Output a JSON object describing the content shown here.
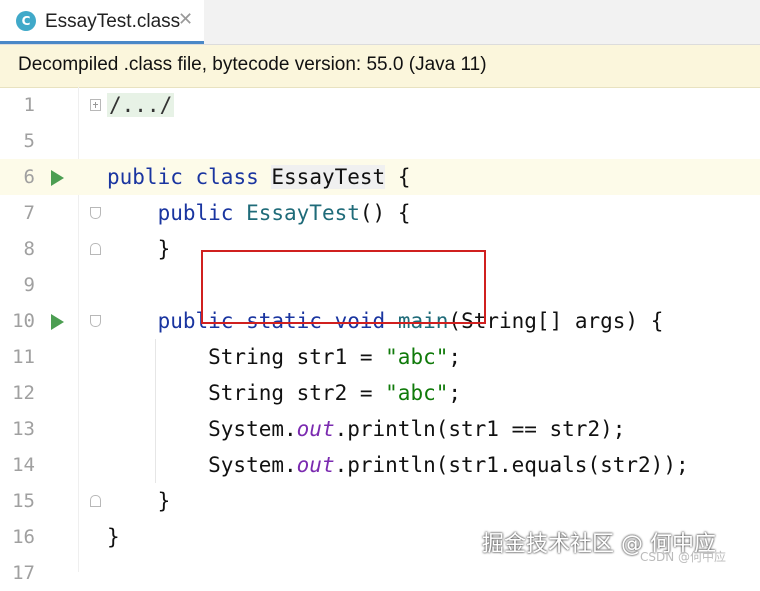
{
  "tab": {
    "icon_letter": "C",
    "icon": "class-file-icon",
    "label": "EssayTest.class",
    "close": "✕"
  },
  "banner": {
    "text": "Decompiled .class file, bytecode version: 55.0 (Java 11)"
  },
  "editor": {
    "lines": [
      {
        "no": "1",
        "text": "/.../"
      },
      {
        "no": "5",
        "text": ""
      },
      {
        "no": "6",
        "text": "public class EssayTest {"
      },
      {
        "no": "7",
        "text": "    public EssayTest() {"
      },
      {
        "no": "8",
        "text": "    }"
      },
      {
        "no": "9",
        "text": ""
      },
      {
        "no": "10",
        "text": "    public static void main(String[] args) {"
      },
      {
        "no": "11",
        "text": "        String str1 = \"abc\";"
      },
      {
        "no": "12",
        "text": "        String str2 = \"abc\";"
      },
      {
        "no": "13",
        "text": "        System.out.println(str1 == str2);"
      },
      {
        "no": "14",
        "text": "        System.out.println(str1.equals(str2));"
      },
      {
        "no": "15",
        "text": "    }"
      },
      {
        "no": "16",
        "text": "}"
      },
      {
        "no": "17",
        "text": ""
      }
    ],
    "tokens": {
      "l1_fold": "/.../",
      "public": "public",
      "class": "class",
      "static": "static",
      "void": "void",
      "classname": "EssayTest",
      "ctor": "EssayTest",
      "main": "main",
      "str_abc": "\"abc\"",
      "out": "out"
    }
  },
  "watermark": {
    "text": "掘金技术社区 @ 何中应",
    "sub": "CSDN @何中应"
  },
  "colors": {
    "keyword": "#1a35a0",
    "string": "#107a0a",
    "static_field": "#7b2bb0",
    "method_decl": "#1f6b79",
    "highlight_box": "#d0201f",
    "run_icon": "#4c9e52",
    "banner_bg": "#fbf6dc"
  }
}
